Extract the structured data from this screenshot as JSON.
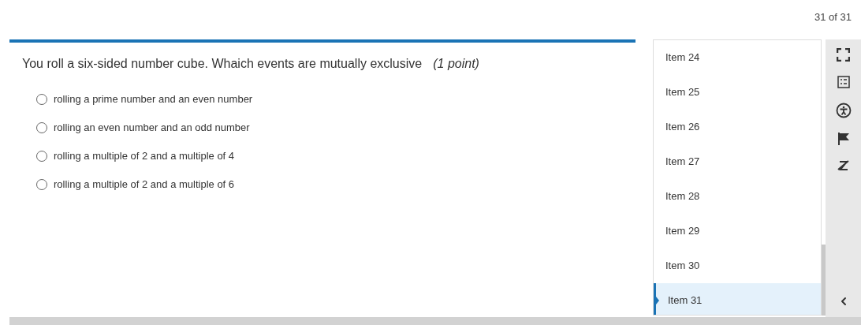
{
  "header": {
    "progress": "31 of 31",
    "level": 1
  },
  "question": {
    "text": "You roll a six-sided number cube.  Whaich events are mutually exclusive",
    "points": "(1 point)"
  },
  "options": [
    {
      "label": "rolling a prime number and an even number",
      "selected": false
    },
    {
      "label": "rolling an even number and an odd number",
      "selected": false
    },
    {
      "label": "rolling a multiple of 2 and a multiple of 4",
      "selected": false
    },
    {
      "label": "rolling a multiple of 2 and a multiple of 6",
      "selected": false
    }
  ],
  "items": [
    {
      "label": "Item 24",
      "selected": false
    },
    {
      "label": "Item 25",
      "selected": false
    },
    {
      "label": "Item 26",
      "selected": false
    },
    {
      "label": "Item 27",
      "selected": false
    },
    {
      "label": "Item 28",
      "selected": false
    },
    {
      "label": "Item 29",
      "selected": false
    },
    {
      "label": "Item 30",
      "selected": false
    },
    {
      "label": "Item 31",
      "selected": true
    }
  ]
}
